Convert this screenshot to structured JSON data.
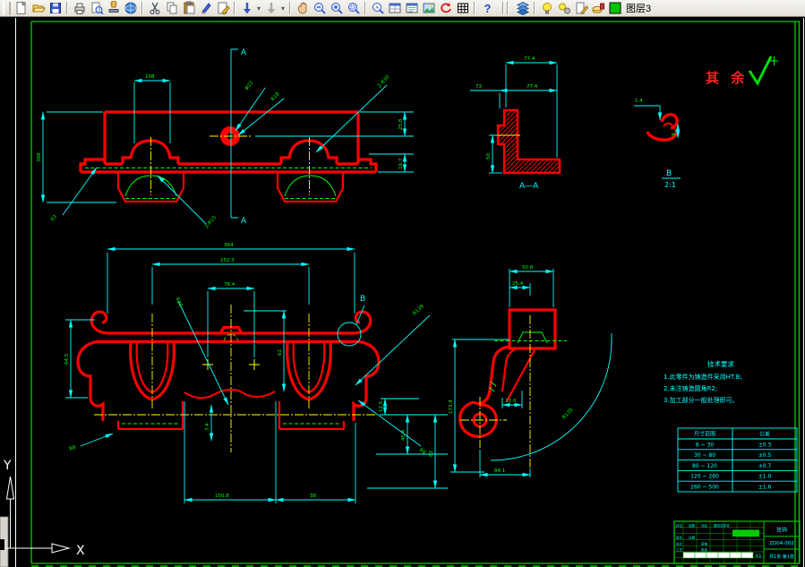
{
  "window": {
    "layer_indicator": "图层3"
  },
  "toolbar": {
    "icon_names": [
      "new",
      "open",
      "save",
      "print",
      "print-preview",
      "stamp",
      "web",
      "cut",
      "copy",
      "paste",
      "format-brush",
      "edit-page",
      "undo",
      "redo",
      "pan",
      "zoom-out",
      "zoom-previous",
      "zoom-window",
      "find",
      "window-grid",
      "window-list",
      "image",
      "refresh",
      "table",
      "help",
      "layers",
      "layer-on",
      "layer-settings",
      "layer-edit",
      "layer-lock",
      "current-layer-color"
    ]
  },
  "colors": {
    "outline": "#ff0000",
    "dimension": "#00ffff",
    "dim_text": "#00ff00",
    "centerline": "#ffff00",
    "hidden": "#00ff00",
    "frame": "#00cc00"
  },
  "drawing": {
    "surface_note": "其 余",
    "axis": {
      "x": "X",
      "y": "Y"
    },
    "front": {
      "section_label_top": "A",
      "section_label_bottom": "A",
      "dims": [
        {
          "t": "108"
        },
        {
          "t": "Φ22"
        },
        {
          "t": "R18"
        },
        {
          "t": "2-R30"
        },
        {
          "t": "368"
        },
        {
          "t": "δ3"
        },
        {
          "t": "2-R15"
        },
        {
          "t": "25.8"
        },
        {
          "t": "16.7"
        }
      ]
    },
    "section": {
      "detail_label": "B",
      "dims": [
        {
          "t": "364"
        },
        {
          "t": "252.3"
        },
        {
          "t": "76.4"
        },
        {
          "t": "R30"
        },
        {
          "t": "64.5"
        },
        {
          "t": "61"
        },
        {
          "t": "R8"
        },
        {
          "t": "7.4"
        },
        {
          "t": "150.8"
        },
        {
          "t": "38"
        },
        {
          "t": "12.5"
        },
        {
          "t": "45.4"
        },
        {
          "t": "82"
        },
        {
          "t": "R139"
        },
        {
          "t": "R6"
        }
      ]
    },
    "side": {
      "dims": [
        {
          "t": "50.8"
        },
        {
          "t": "25.4"
        },
        {
          "t": "173.4"
        },
        {
          "t": "22.0"
        },
        {
          "t": "R135"
        },
        {
          "t": "84.1"
        }
      ]
    },
    "aa": {
      "label": "A—A",
      "dims": [
        {
          "t": "77.4"
        },
        {
          "t": "73"
        },
        {
          "t": "77.4"
        },
        {
          "t": "50"
        }
      ]
    },
    "bdetail": {
      "label": "B",
      "scale": "2:1",
      "dims": [
        {
          "t": "1.4"
        },
        {
          "t": "3"
        }
      ]
    }
  },
  "notes": {
    "title": "技术要求",
    "items": [
      "1.此零件为铸造件采用HT.B;",
      "2.未注铸造圆角R2;",
      "3.加工部分一般处理即可。"
    ]
  },
  "tolerance_table": {
    "headers": [
      "尺寸范围",
      "公差"
    ],
    "rows": [
      [
        "6 ~ 30",
        "±0.3"
      ],
      [
        "30 ~ 80",
        "±0.5"
      ],
      [
        "80 ~ 120",
        "±0.7"
      ],
      [
        "120 ~ 260",
        "±1.0"
      ],
      [
        "260 ~ 500",
        "±1.6"
      ]
    ]
  },
  "title_block": {
    "part_name": "挂钩",
    "drawing_no": "ZD04-002",
    "sheet": "共1张 第1张",
    "tolerance": "±1",
    "small_labels": [
      "标记",
      "处数",
      "分区",
      "更改文件号",
      "签名",
      "日期",
      "设计",
      "审核",
      "工艺",
      "批准"
    ]
  }
}
